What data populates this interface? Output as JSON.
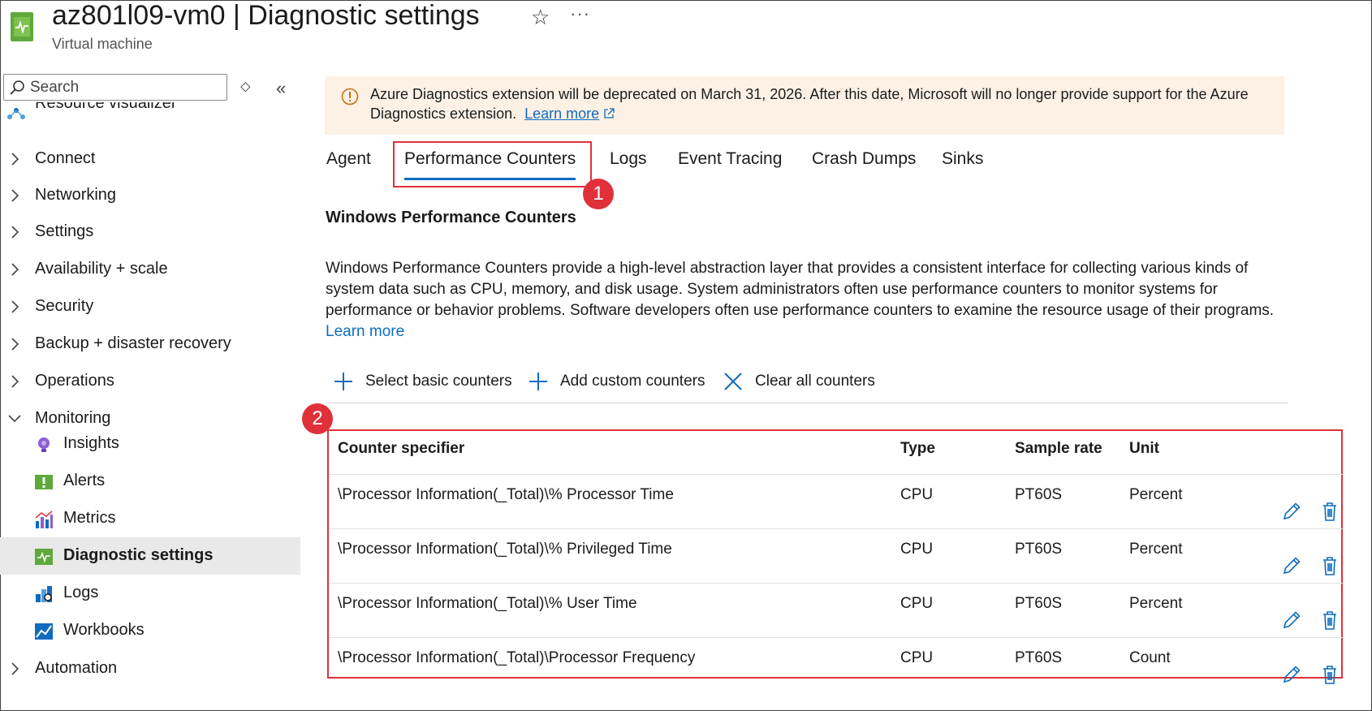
{
  "header": {
    "title": "az801l09-vm0 | Diagnostic settings",
    "subtitle": "Virtual machine",
    "favorite_icon": "star-icon",
    "more_icon": "ellipsis-icon",
    "more_label": "···",
    "star_label": "☆"
  },
  "sidebar": {
    "search_placeholder": "Search",
    "partial_item": "Resource visualizer",
    "items": [
      {
        "label": "Connect"
      },
      {
        "label": "Networking"
      },
      {
        "label": "Settings"
      },
      {
        "label": "Availability + scale"
      },
      {
        "label": "Security"
      },
      {
        "label": "Backup + disaster recovery"
      },
      {
        "label": "Operations"
      },
      {
        "label": "Monitoring"
      }
    ],
    "monitoring_children": [
      {
        "label": "Insights",
        "icon": "insights-icon"
      },
      {
        "label": "Alerts",
        "icon": "alerts-icon"
      },
      {
        "label": "Metrics",
        "icon": "metrics-icon"
      },
      {
        "label": "Diagnostic settings",
        "icon": "diagnostic-settings-icon",
        "active": true
      },
      {
        "label": "Logs",
        "icon": "logs-icon"
      },
      {
        "label": "Workbooks",
        "icon": "workbooks-icon"
      }
    ],
    "last_item": "Automation"
  },
  "banner": {
    "text": "Azure Diagnostics extension will be deprecated on March 31, 2026. After this date, Microsoft will no longer provide support for the Azure Diagnostics extension.",
    "link": "Learn more"
  },
  "tabs": [
    "Agent",
    "Performance Counters",
    "Logs",
    "Event Tracing",
    "Crash Dumps",
    "Sinks"
  ],
  "callouts": [
    "1",
    "2"
  ],
  "section": {
    "title": "Windows Performance Counters",
    "description": "Windows Performance Counters provide a high-level abstraction layer that provides a consistent interface for collecting various kinds of system data such as CPU, memory, and disk usage. System administrators often use performance counters to monitor systems for performance or behavior problems. Software developers often use performance counters to examine the resource usage of their programs.",
    "learn_more": "Learn more"
  },
  "toolbar": {
    "select_basic": "Select basic counters",
    "add_custom": "Add custom counters",
    "clear_all": "Clear all counters"
  },
  "table": {
    "headers": [
      "Counter specifier",
      "Type",
      "Sample rate",
      "Unit"
    ],
    "rows": [
      {
        "specifier": "\\Processor Information(_Total)\\% Processor Time",
        "type": "CPU",
        "rate": "PT60S",
        "unit": "Percent"
      },
      {
        "specifier": "\\Processor Information(_Total)\\% Privileged Time",
        "type": "CPU",
        "rate": "PT60S",
        "unit": "Percent"
      },
      {
        "specifier": "\\Processor Information(_Total)\\% User Time",
        "type": "CPU",
        "rate": "PT60S",
        "unit": "Percent"
      },
      {
        "specifier": "\\Processor Information(_Total)\\Processor Frequency",
        "type": "CPU",
        "rate": "PT60S",
        "unit": "Count"
      }
    ]
  },
  "colors": {
    "accent": "#0f6cbd",
    "callout": "#e0303a",
    "banner_bg": "#fdf1e5",
    "warning": "#c5700b"
  }
}
